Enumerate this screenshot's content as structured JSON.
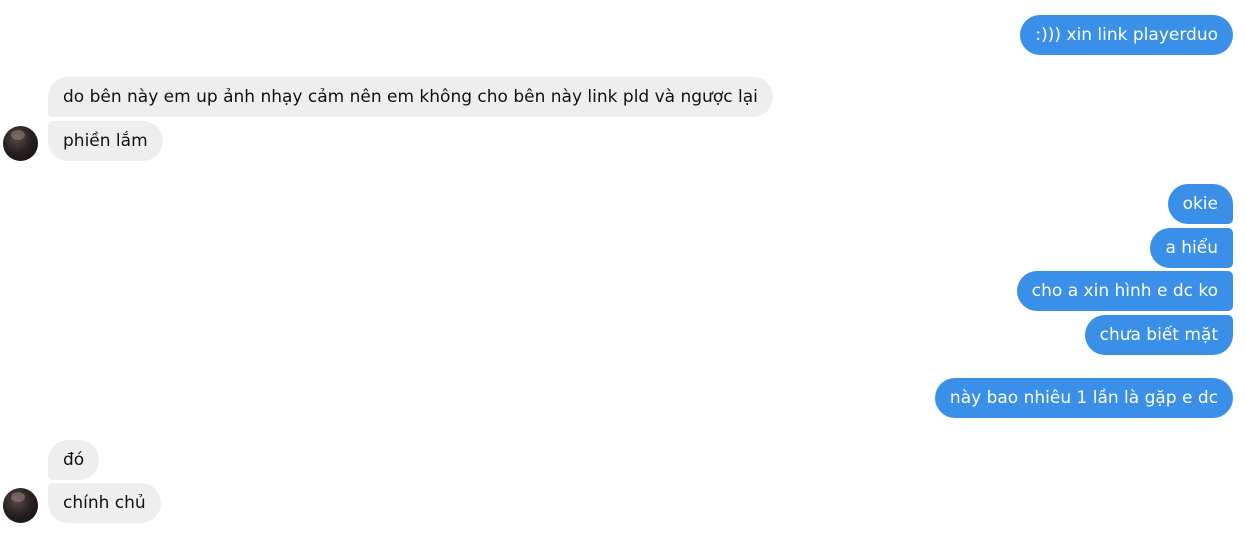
{
  "messages": [
    {
      "id": "m1",
      "side": "out",
      "text": ":))) xin link playerduo"
    },
    {
      "id": "m2",
      "side": "in",
      "text": "do bên này em up ảnh nhạy cảm nên em không cho bên này link pld và ngược lại"
    },
    {
      "id": "m3",
      "side": "in",
      "text": "phiền lắm"
    },
    {
      "id": "m4",
      "side": "out",
      "text": "okie"
    },
    {
      "id": "m5",
      "side": "out",
      "text": "a hiểu"
    },
    {
      "id": "m6",
      "side": "out",
      "text": "cho a xin hình e dc ko"
    },
    {
      "id": "m7",
      "side": "out",
      "text": "chưa biết mặt"
    },
    {
      "id": "m8",
      "side": "out",
      "text": "này bao nhiêu 1 lần là gặp e dc"
    },
    {
      "id": "m9",
      "side": "in",
      "text": "đó"
    },
    {
      "id": "m10",
      "side": "in",
      "text": "chính chủ"
    }
  ],
  "colors": {
    "outgoing_bubble": "#3a8fe8",
    "incoming_bubble": "#eeeeee",
    "background": "#ffffff"
  }
}
